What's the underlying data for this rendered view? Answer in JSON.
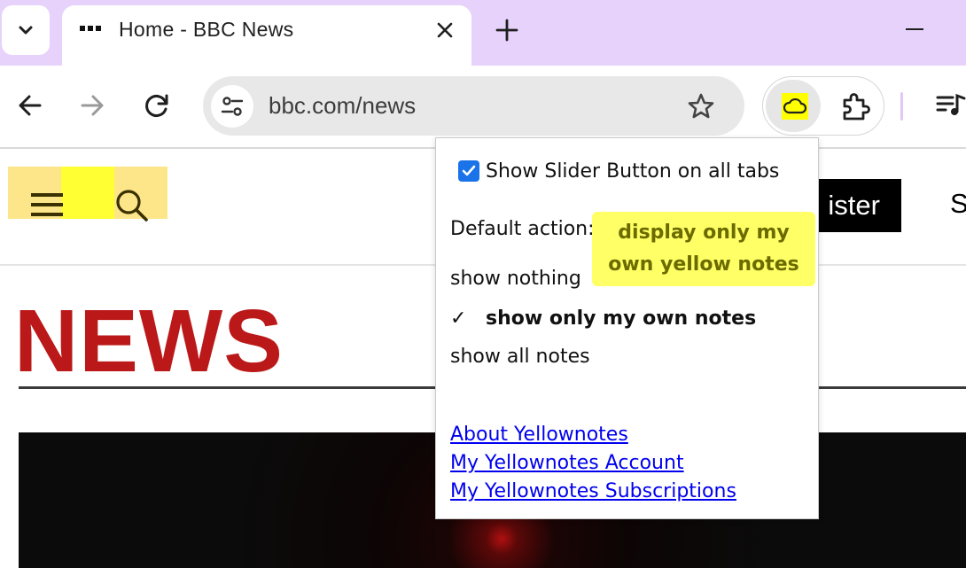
{
  "browser": {
    "tab": {
      "title": "Home - BBC News"
    },
    "omnibox": {
      "url": "bbc.com/news"
    },
    "colors": {
      "tabstrip": "#e7d2fb",
      "extension_icon": "#ffff00"
    },
    "icons": [
      "tab-search-icon",
      "close-icon",
      "new-tab-icon",
      "minimize-icon",
      "back-icon",
      "forward-icon",
      "reload-icon",
      "site-info-icon",
      "bookmark-star-icon",
      "yellownotes-cloud-icon",
      "extensions-puzzle-icon",
      "media-controls-icon"
    ]
  },
  "page": {
    "register_label": "ister",
    "signin_partial": "S",
    "logo_text": "NEWS",
    "colors": {
      "logo": "#bb1919",
      "highlight": "#fde68a",
      "highlight_strong": "#ffff33"
    }
  },
  "popup": {
    "slider_checkbox": {
      "label": "Show Slider Button on all tabs",
      "checked": true
    },
    "default_action_label": "Default action:",
    "tooltip": "display only my own yellow notes",
    "options": {
      "nothing": "show nothing",
      "own": "show only my own notes",
      "all": "show all notes",
      "selected": "own",
      "check_mark": "✓"
    },
    "links": {
      "about": "About Yellownotes",
      "account": "My Yellownotes Account",
      "subscriptions": "My Yellownotes Subscriptions"
    },
    "colors": {
      "tooltip_bg": "#ffff66",
      "tooltip_text": "#6b6b00",
      "link": "#0000ee"
    }
  }
}
